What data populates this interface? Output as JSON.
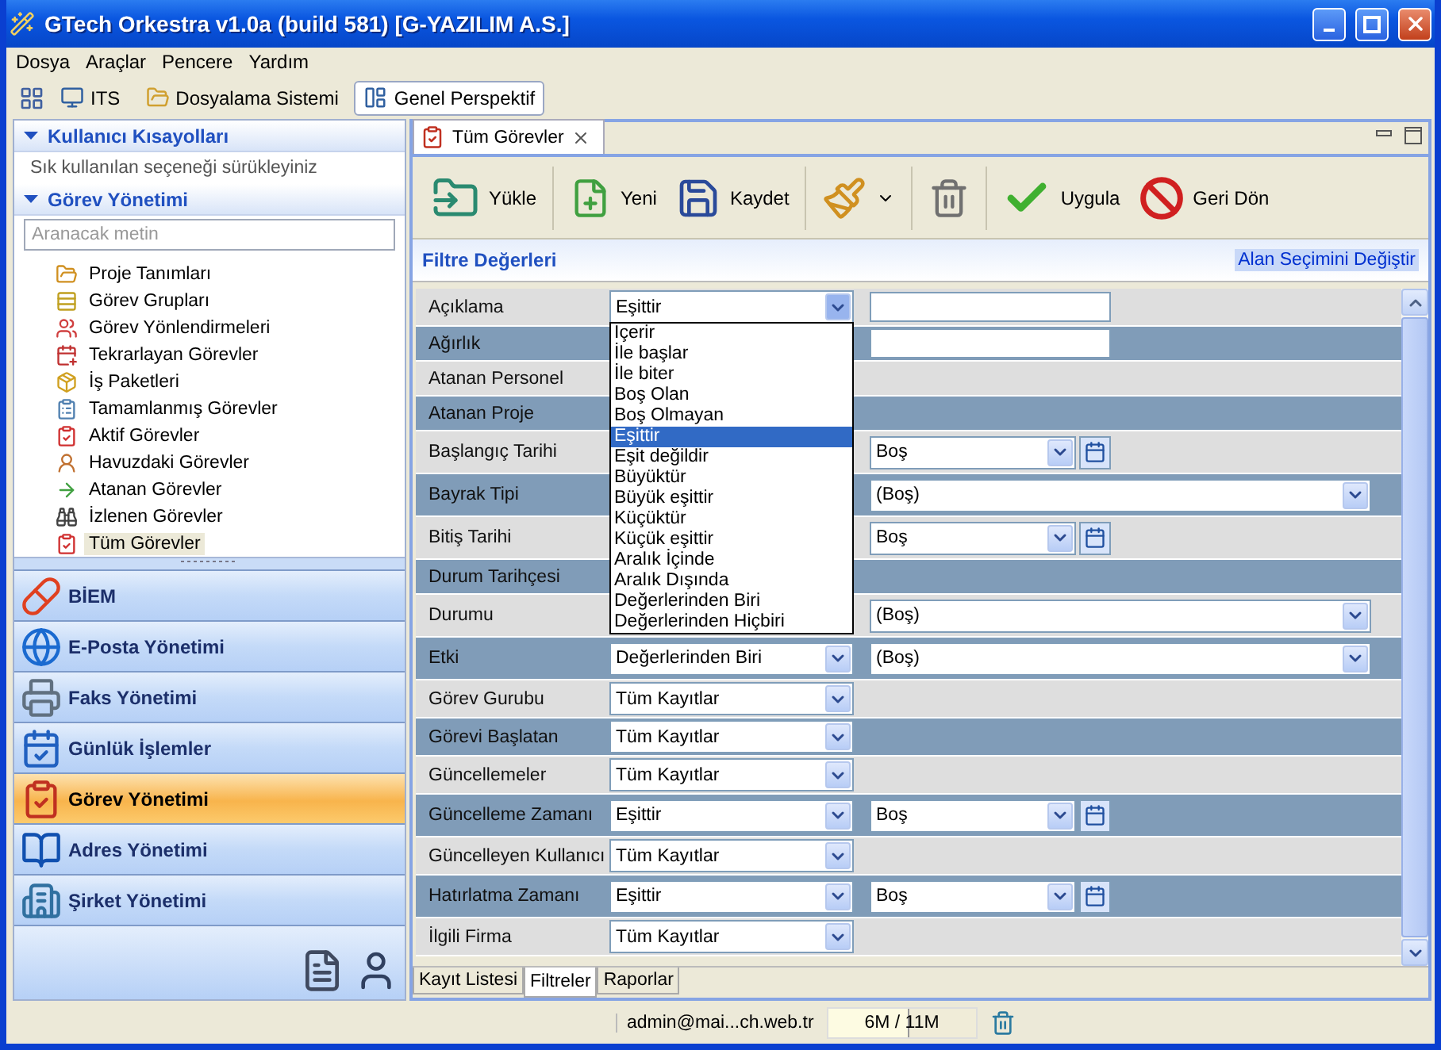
{
  "window": {
    "title": "GTech Orkestra v1.0a (build 581) [G-YAZILIM A.S.]"
  },
  "menu": [
    "Dosya",
    "Araçlar",
    "Pencere",
    "Yardım"
  ],
  "perspective_bar": [
    {
      "label": "ITS",
      "selected": false
    },
    {
      "label": "Dosyalama Sistemi",
      "selected": false
    },
    {
      "label": "Genel Perspektif",
      "selected": true
    }
  ],
  "sidebar": {
    "shortcuts": {
      "title": "Kullanıcı Kısayolları",
      "expanded": true,
      "hint": "Sık kullanılan seçeneği sürükleyiniz"
    },
    "tasks": {
      "title": "Görev Yönetimi",
      "expanded": true,
      "search_placeholder": "Aranacak metin",
      "items": [
        {
          "label": "Proje Tanımları",
          "selected": false
        },
        {
          "label": "Görev Grupları",
          "selected": false
        },
        {
          "label": "Görev Yönlendirmeleri",
          "selected": false
        },
        {
          "label": "Tekrarlayan Görevler",
          "selected": false
        },
        {
          "label": "İş Paketleri",
          "selected": false
        },
        {
          "label": "Tamamlanmış Görevler",
          "selected": false
        },
        {
          "label": "Aktif Görevler",
          "selected": false
        },
        {
          "label": "Havuzdaki Görevler",
          "selected": false
        },
        {
          "label": "Atanan Görevler",
          "selected": false
        },
        {
          "label": "İzlenen Görevler",
          "selected": false
        },
        {
          "label": "Tüm Görevler",
          "selected": true
        }
      ]
    },
    "modules": [
      {
        "label": "BİEM",
        "selected": false
      },
      {
        "label": "E-Posta Yönetimi",
        "selected": false
      },
      {
        "label": "Faks Yönetimi",
        "selected": false
      },
      {
        "label": "Günlük İşlemler",
        "selected": false
      },
      {
        "label": "Görev Yönetimi",
        "selected": true
      },
      {
        "label": "Adres Yönetimi",
        "selected": false
      },
      {
        "label": "Şirket Yönetimi",
        "selected": false
      }
    ]
  },
  "editor": {
    "tab": "Tüm Görevler",
    "toolbar": [
      "Yükle",
      "Yeni",
      "Kaydet",
      "Uygula",
      "Geri Dön"
    ],
    "filter": {
      "title": "Filtre Değerleri",
      "field_choice_link": "Alan Seçimini Değiştir",
      "rows": [
        {
          "label": "Açıklama",
          "operator": "Eşittir",
          "operator_open": true,
          "kind": "text",
          "options": [
            {
              "label": "İçerir",
              "selected": false
            },
            {
              "label": "İle başlar",
              "selected": false
            },
            {
              "label": "İle biter",
              "selected": false
            },
            {
              "label": "Boş Olan",
              "selected": false
            },
            {
              "label": "Boş Olmayan",
              "selected": false
            },
            {
              "label": "Eşittir",
              "selected": true
            },
            {
              "label": "Eşit değildir",
              "selected": false
            },
            {
              "label": "Büyüktür",
              "selected": false
            },
            {
              "label": "Büyük eşittir",
              "selected": false
            },
            {
              "label": "Küçüktür",
              "selected": false
            },
            {
              "label": "Küçük eşittir",
              "selected": false
            },
            {
              "label": "Aralık İçinde",
              "selected": false
            },
            {
              "label": "Aralık Dışında",
              "selected": false
            },
            {
              "label": "Değerlerinden Biri",
              "selected": false
            },
            {
              "label": "Değerlerinden Hiçbiri",
              "selected": false
            }
          ]
        },
        {
          "label": "Ağırlık",
          "kind": "text"
        },
        {
          "label": "Atanan Personel",
          "kind": "none"
        },
        {
          "label": "Atanan Proje",
          "kind": "none"
        },
        {
          "label": "Başlangıç Tarihi",
          "kind": "date",
          "value": "Boş"
        },
        {
          "label": "Bayrak Tipi",
          "kind": "choice",
          "value": "(Boş)"
        },
        {
          "label": "Bitiş Tarihi",
          "kind": "date",
          "value": "Boş"
        },
        {
          "label": "Durum Tarihçesi",
          "kind": "none"
        },
        {
          "label": "Durumu",
          "kind": "choice",
          "value": "(Boş)"
        },
        {
          "label": "Etki",
          "operator": "Değerlerinden Biri",
          "operator_open": false,
          "kind": "choice",
          "value": "(Boş)"
        },
        {
          "label": "Görev Gurubu",
          "operator": "Tüm Kayıtlar",
          "operator_open": false,
          "kind": "none"
        },
        {
          "label": "Görevi Başlatan",
          "operator": "Tüm Kayıtlar",
          "operator_open": false,
          "kind": "none"
        },
        {
          "label": "Güncellemeler",
          "operator": "Tüm Kayıtlar",
          "operator_open": false,
          "kind": "none"
        },
        {
          "label": "Güncelleme Zamanı",
          "operator": "Eşittir",
          "operator_open": false,
          "kind": "date",
          "value": "Boş"
        },
        {
          "label": "Güncelleyen Kullanıcı",
          "operator": "Tüm Kayıtlar",
          "operator_open": false,
          "kind": "none"
        },
        {
          "label": "Hatırlatma Zamanı",
          "operator": "Eşittir",
          "operator_open": false,
          "kind": "date",
          "value": "Boş"
        },
        {
          "label": "İlgili Firma",
          "operator": "Tüm Kayıtlar",
          "operator_open": false,
          "kind": "none"
        }
      ]
    },
    "bottom_tabs": [
      {
        "label": "Kayıt Listesi",
        "selected": false
      },
      {
        "label": "Filtreler",
        "selected": true
      },
      {
        "label": "Raporlar",
        "selected": false
      }
    ]
  },
  "status_bar": {
    "user": "admin@mai...ch.web.tr",
    "memory": "6M / 11M",
    "level": 0.55
  }
}
